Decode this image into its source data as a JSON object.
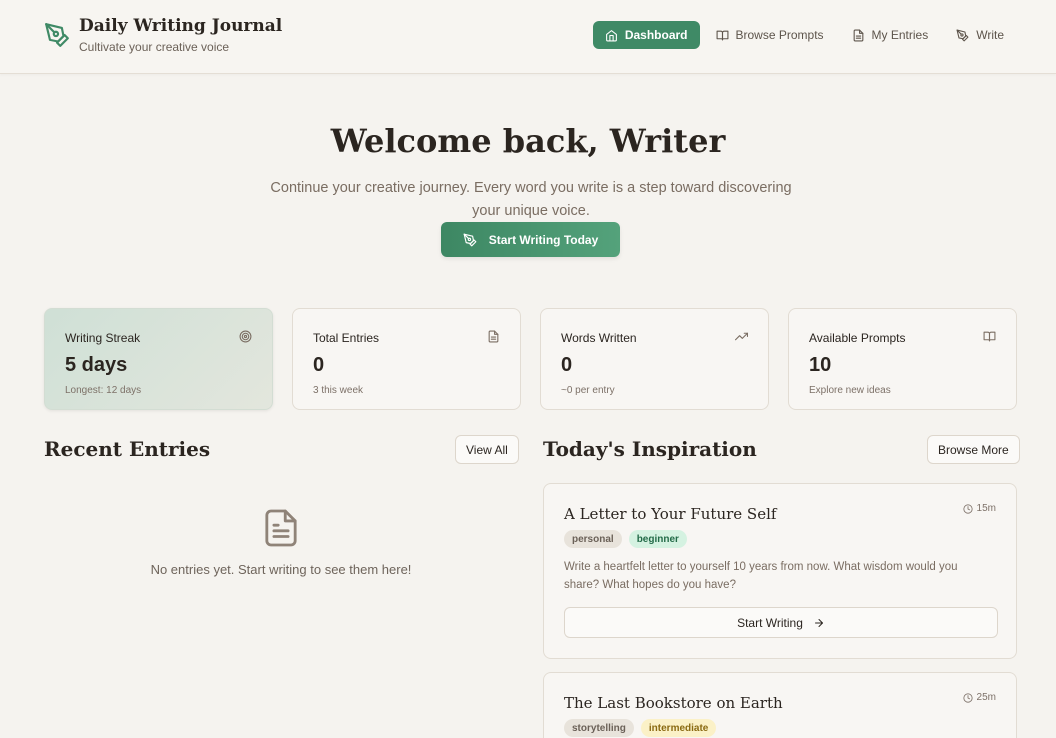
{
  "brand": {
    "title": "Daily Writing Journal",
    "subtitle": "Cultivate your creative voice"
  },
  "nav": [
    {
      "label": "Dashboard",
      "icon": "home-icon",
      "active": true
    },
    {
      "label": "Browse Prompts",
      "icon": "book-icon",
      "active": false
    },
    {
      "label": "My Entries",
      "icon": "file-icon",
      "active": false
    },
    {
      "label": "Write",
      "icon": "pen-icon",
      "active": false
    }
  ],
  "hero": {
    "title": "Welcome back, Writer",
    "text": "Continue your creative journey. Every word you write is a step toward discovering your unique voice.",
    "cta": "Start Writing Today"
  },
  "stats": [
    {
      "label": "Writing Streak",
      "value": "5 days",
      "note": "Longest: 12 days",
      "icon": "target-icon"
    },
    {
      "label": "Total Entries",
      "value": "0",
      "note": "3 this week",
      "icon": "file-icon"
    },
    {
      "label": "Words Written",
      "value": "0",
      "note": "~0 per entry",
      "icon": "trending-up-icon"
    },
    {
      "label": "Available Prompts",
      "value": "10",
      "note": "Explore new ideas",
      "icon": "book-icon"
    }
  ],
  "recent": {
    "title": "Recent Entries",
    "view_all": "View All",
    "empty_text": "No entries yet. Start writing to see them here!"
  },
  "inspiration": {
    "title": "Today's Inspiration",
    "browse_more": "Browse More",
    "prompts": [
      {
        "title": "A Letter to Your Future Self",
        "time": "15m",
        "category": "personal",
        "difficulty": "beginner",
        "description": "Write a heartfelt letter to yourself 10 years from now. What wisdom would you share? What hopes do you have?",
        "button": "Start Writing"
      },
      {
        "title": "The Last Bookstore on Earth",
        "time": "25m",
        "category": "storytelling",
        "difficulty": "intermediate"
      }
    ]
  },
  "colors": {
    "accent": "#3f8a66",
    "background": "#f5f3ef",
    "text": "#2b2520"
  }
}
